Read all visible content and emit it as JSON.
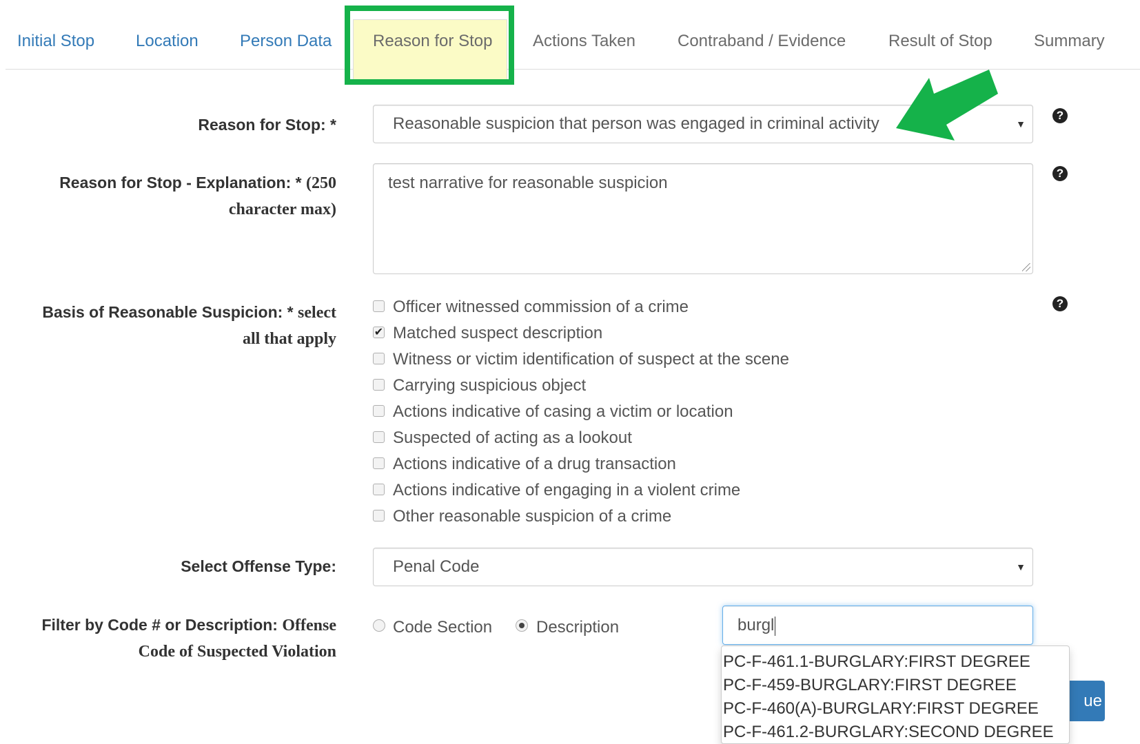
{
  "tabs": [
    {
      "label": "Initial Stop"
    },
    {
      "label": "Location"
    },
    {
      "label": "Person Data"
    },
    {
      "label": "Reason for Stop"
    },
    {
      "label": "Actions Taken"
    },
    {
      "label": "Contraband / Evidence"
    },
    {
      "label": "Result of Stop"
    },
    {
      "label": "Summary"
    }
  ],
  "reason": {
    "label": "Reason for Stop: *",
    "selected": "Reasonable suspicion that person was engaged in criminal activity",
    "caret": "▼"
  },
  "explanation": {
    "label": "Reason for Stop - Explanation: *",
    "hint1": "(250",
    "hint2": "character max)",
    "value": "test narrative for reasonable suspicion"
  },
  "basis": {
    "label": "Basis of Reasonable Suspicion: *",
    "hint1": "select",
    "hint2": "all that apply",
    "options": [
      {
        "label": "Officer witnessed commission of a crime",
        "checked": false
      },
      {
        "label": "Matched suspect description",
        "checked": true
      },
      {
        "label": "Witness or victim identification of suspect at the scene",
        "checked": false
      },
      {
        "label": "Carrying suspicious object",
        "checked": false
      },
      {
        "label": "Actions indicative of casing a victim or location",
        "checked": false
      },
      {
        "label": "Suspected of acting as a lookout",
        "checked": false
      },
      {
        "label": "Actions indicative of a drug transaction",
        "checked": false
      },
      {
        "label": "Actions indicative of engaging in a violent crime",
        "checked": false
      },
      {
        "label": "Other reasonable suspicion of a crime",
        "checked": false
      }
    ]
  },
  "offense_type": {
    "label": "Select Offense Type:",
    "selected": "Penal Code",
    "caret": "▼"
  },
  "filter": {
    "label": "Filter by Code # or Description:",
    "hint1": "Offense",
    "hint2": "Code of Suspected Violation",
    "radio_code": "Code Section",
    "radio_desc": "Description",
    "selected_radio": "Description",
    "input_value": "burgl",
    "suggestions": [
      "PC-F-461.1-BURGLARY:FIRST DEGREE",
      "PC-F-459-BURGLARY:FIRST DEGREE",
      "PC-F-460(A)-BURGLARY:FIRST DEGREE",
      "PC-F-461.2-BURGLARY:SECOND DEGREE"
    ]
  },
  "continue_label": "ue",
  "help_glyph": "?",
  "colors": {
    "link": "#337ab7",
    "highlight_border": "#15b24a",
    "highlight_fill": "#fbfbc6",
    "arrow": "#15b24a"
  }
}
